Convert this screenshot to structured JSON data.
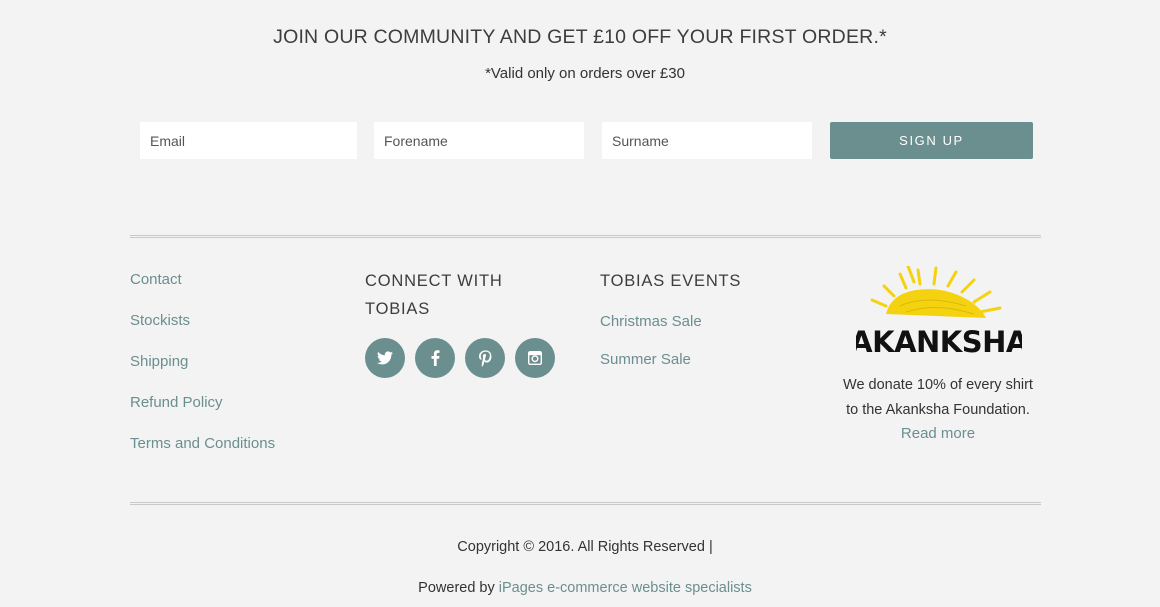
{
  "promo": {
    "title": "JOIN OUR COMMUNITY AND GET £10 OFF YOUR FIRST ORDER.*",
    "subtitle": "*Valid only on orders over £30"
  },
  "signup_form": {
    "email_placeholder": "Email",
    "forename_placeholder": "Forename",
    "surname_placeholder": "Surname",
    "submit_label": "SIGN UP"
  },
  "footer": {
    "links": [
      "Contact",
      "Stockists",
      "Shipping",
      "Refund Policy",
      "Terms and Conditions"
    ],
    "connect": {
      "heading_line1": "CONNECT WITH",
      "heading_line2": "TOBIAS",
      "icons": [
        "twitter-icon",
        "facebook-icon",
        "pinterest-icon",
        "instagram-icon"
      ]
    },
    "events": {
      "heading": "TOBIAS EVENTS",
      "items": [
        "Christmas Sale",
        "Summer Sale"
      ]
    },
    "charity": {
      "logo_text": "AKANKSHA",
      "text_line1": "We donate 10% of every shirt",
      "text_line2": "to the Akanksha Foundation.",
      "read_more": "Read more"
    },
    "copyright": "Copyright © 2016. All Rights Reserved |",
    "powered_prefix": "Powered by",
    "powered_link": "iPages e-commerce website specialists"
  },
  "colors": {
    "accent": "#6b8e8f",
    "background": "#f3f3f3",
    "logo_sun": "#f5d20f"
  }
}
